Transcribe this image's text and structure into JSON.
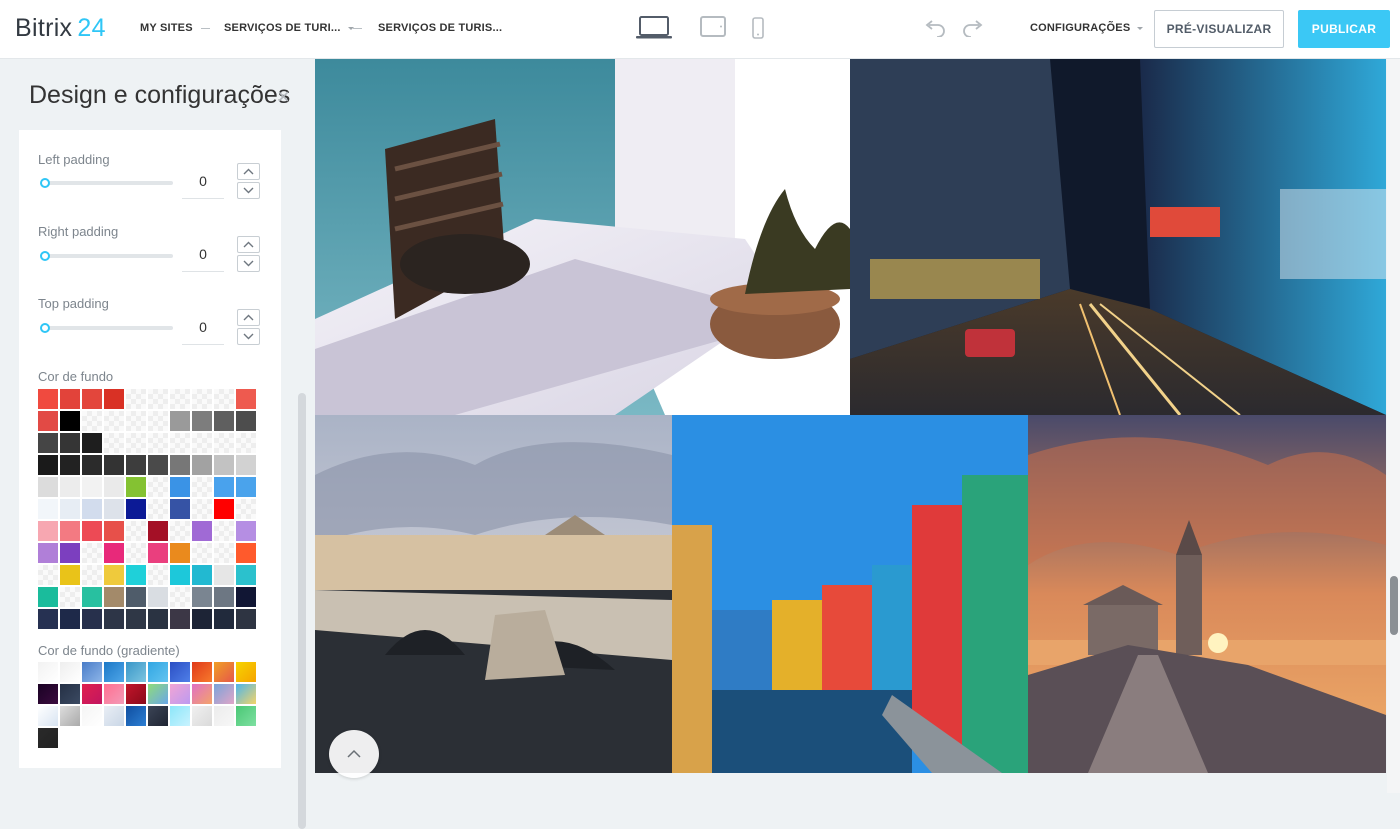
{
  "app": {
    "logo_text": "Bitrix",
    "logo_number": "24"
  },
  "breadcrumbs": [
    {
      "label": "MY SITES"
    },
    {
      "label": "SERVIÇOS DE TURI...",
      "has_dropdown": true
    },
    {
      "label": "SERVIÇOS DE TURIS..."
    }
  ],
  "devices": [
    "laptop-icon",
    "tablet-icon",
    "mobile-icon"
  ],
  "toolbar": {
    "settings_label": "CONFIGURAÇÕES",
    "preview_label": "PRÉ-VISUALIZAR",
    "publish_label": "PUBLICAR"
  },
  "sidebar": {
    "title": "Design e configurações",
    "controls": [
      {
        "label": "Left padding",
        "value": "0"
      },
      {
        "label": "Right padding",
        "value": "0"
      },
      {
        "label": "Top padding",
        "value": "0"
      }
    ],
    "bg_color_label": "Cor de fundo",
    "bg_gradient_label": "Cor de fundo (gradiente)"
  },
  "colors": {
    "accent": "#2fc6f6",
    "primary_button": "#3bc8f5",
    "solid_swatches": [
      "#f04a3f",
      "#e2433a",
      "#e3463c",
      "#d93125",
      "chk",
      "chk",
      "chk",
      "chk",
      "chk",
      "#ee5a4f",
      "#e24a45",
      "#000000",
      "chk",
      "chk",
      "chk",
      "chk",
      "#9a9a9a",
      "#7d7d7d",
      "#5f5f5f",
      "#4d4d4d",
      "#454545",
      "#353535",
      "#1e1e1e",
      "chk",
      "chk",
      "chk",
      "chk",
      "chk",
      "chk",
      "chk",
      "#1a1a1a",
      "#222222",
      "#2b2b2b",
      "#333333",
      "#3d3d3d",
      "#4a4a4a",
      "#777777",
      "#a2a2a2",
      "#c2c2c2",
      "#d2d2d2",
      "#dcdcdc",
      "#ececec",
      "#f2f2f2",
      "#eaeaea",
      "#84c232",
      "chk",
      "#3a93e6",
      "chk",
      "#49a2ed",
      "#4aa3ec",
      "#f2f6fa",
      "#e7edf4",
      "#d2dced",
      "#dde2ea",
      "#0c1a96",
      "chk",
      "#3653a5",
      "chk",
      "#ff0000",
      "chk",
      "#f7a7b1",
      "#f37a82",
      "#ed4a55",
      "#e7504a",
      "chk",
      "#a41026",
      "chk",
      "#a06ad5",
      "chk",
      "#b58ee3",
      "#b07fd8",
      "#7c3fbf",
      "chk",
      "#e8297a",
      "chk",
      "#ea3f7e",
      "#ea8a1d",
      "chk",
      "chk",
      "#ff5a2c",
      "chk",
      "#e9c319",
      "chk",
      "#efca3c",
      "#1fd0d9",
      "chk",
      "#1dc8da",
      "#22b9d1",
      "#e6e6e6",
      "#2bc1cd",
      "#1abc9c",
      "chk",
      "#28c0a0",
      "#a38a6a",
      "#4f5c6a",
      "#d9dde2",
      "chk",
      "#7a8591",
      "#6d7783",
      "#111634",
      "#263152",
      "#1e2949",
      "#27304c",
      "#2d3547",
      "#2f3746",
      "#2a3342",
      "#3c3746",
      "#1d2436",
      "#212a3c",
      "#2e3442"
    ],
    "gradient_swatches": [
      [
        "#f2f2f2",
        "#ffffff"
      ],
      [
        "#eeeeee",
        "#ffffff"
      ],
      [
        "#4a7dc8",
        "#8db5e8"
      ],
      [
        "#1c78c7",
        "#4fa6e8"
      ],
      [
        "#3996c8",
        "#7dc5e0"
      ],
      [
        "#31a6e3",
        "#63c4f0"
      ],
      [
        "#2b4fc4",
        "#4f7fe8"
      ],
      [
        "#e03a1a",
        "#f77a2c"
      ],
      [
        "#f0a024",
        "#e6574a"
      ],
      [
        "#f7d400",
        "#f5a300"
      ],
      [
        "#1a0224",
        "#3a0b3e"
      ],
      [
        "#253045",
        "#3b4a62"
      ],
      [
        "#e0214e",
        "#c21560"
      ],
      [
        "#ff6f91",
        "#f39ab7"
      ],
      [
        "#c2152b",
        "#8a0a1a"
      ],
      [
        "#8fdb7a",
        "#6aa7e8"
      ],
      [
        "#f2a5d4",
        "#bc9af0"
      ],
      [
        "#e070c4",
        "#f3a36a"
      ],
      [
        "#7aa3d9",
        "#e0a6c8"
      ],
      [
        "#4db5ea",
        "#f3d469"
      ],
      [
        "#ffffff",
        "#d8e4f2"
      ],
      [
        "#dddddd",
        "#aaaaaa"
      ],
      [
        "#f5f5f5",
        "#ffffff"
      ],
      [
        "#e9eef5",
        "#c9d6e6"
      ],
      [
        "#0f4ea0",
        "#2d7fd3"
      ],
      [
        "#3b4456",
        "#1f2533"
      ],
      [
        "#8ce6f9",
        "#c9f3ff"
      ],
      [
        "#f0f0f0",
        "#dadada"
      ],
      [
        "#ececec",
        "#f7f7f7"
      ],
      [
        "#4ac775",
        "#7ee0a1"
      ],
      [
        "#2a2a2a",
        "#222222"
      ]
    ]
  }
}
